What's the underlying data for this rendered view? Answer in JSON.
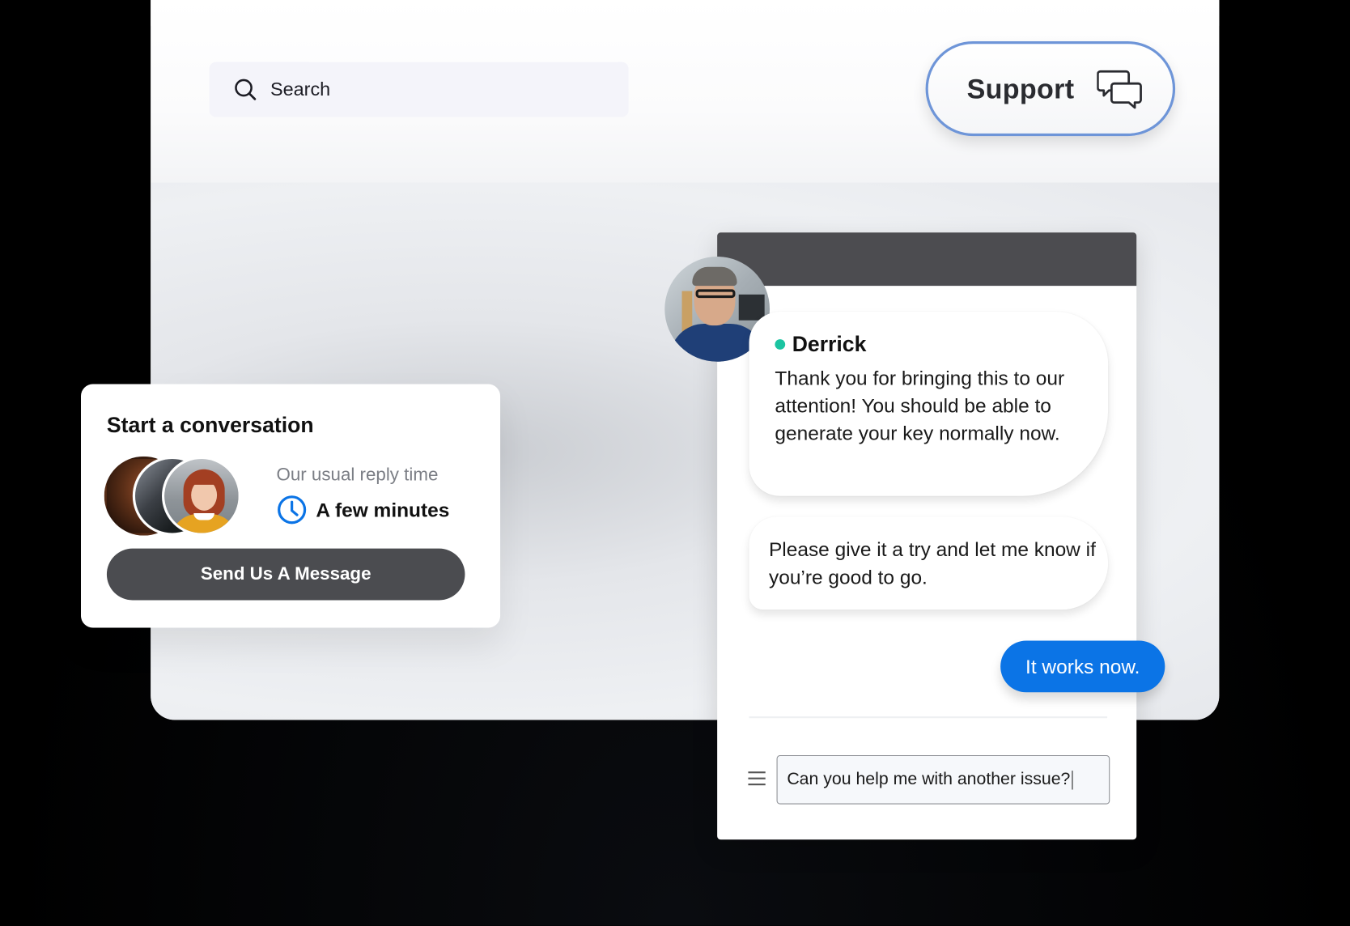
{
  "search": {
    "placeholder": "Search"
  },
  "support_button": {
    "label": "Support",
    "icon": "chat-bubbles-icon"
  },
  "start_card": {
    "title": "Start a conversation",
    "reply_caption": "Our usual reply time",
    "reply_time": "A few minutes",
    "send_button_label": "Send Us A Message",
    "clock_icon_color": "#0b74e6"
  },
  "chat": {
    "agent_name": "Derrick",
    "agent_status_color": "#1bc4a1",
    "messages": [
      {
        "from": "agent",
        "text": "Thank you for bringing this to our attention! You should be able to generate your key normally now."
      },
      {
        "from": "agent",
        "text": "Please give it a try and let me know if you’re good to go."
      },
      {
        "from": "user",
        "text": "It works now."
      }
    ],
    "input_value": "Can you help me with another issue?",
    "user_bubble_color": "#0b74e6"
  }
}
